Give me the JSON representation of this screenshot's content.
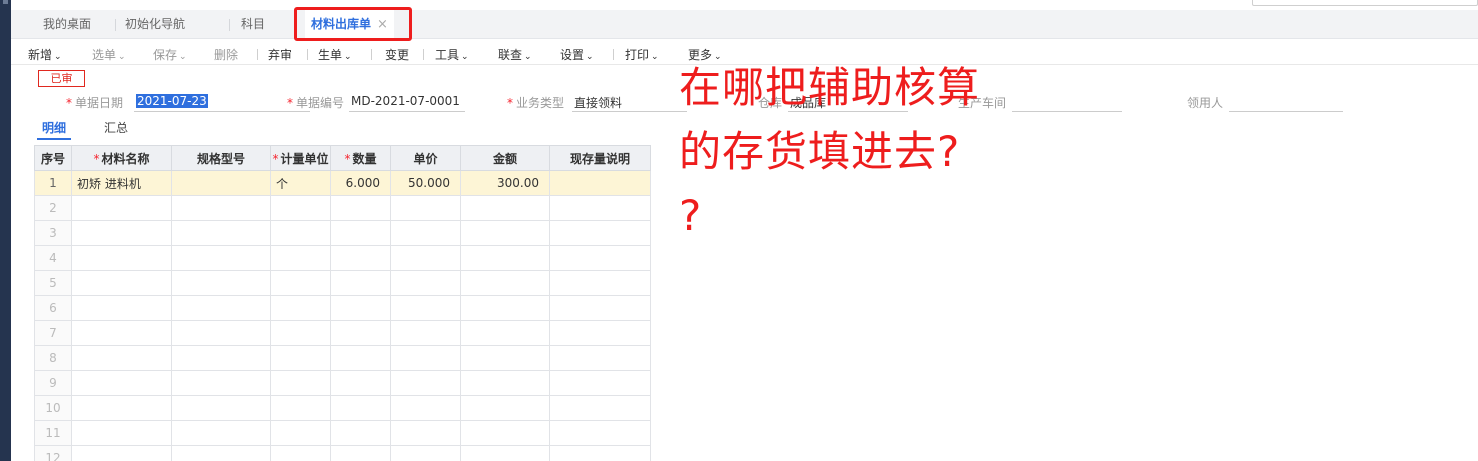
{
  "tabs": [
    {
      "label": "我的桌面",
      "active": false
    },
    {
      "label": "初始化导航",
      "active": false
    },
    {
      "label": "科目",
      "active": false
    },
    {
      "label": "材料出库单",
      "active": true
    }
  ],
  "tab_close_glyph": "×",
  "toolbar": [
    {
      "label": "新增",
      "dropdown": true,
      "disabled": false
    },
    {
      "label": "选单",
      "dropdown": true,
      "disabled": true
    },
    {
      "label": "保存",
      "dropdown": true,
      "disabled": true
    },
    {
      "label": "删除",
      "dropdown": false,
      "disabled": true
    },
    {
      "label": "弃审",
      "dropdown": false,
      "disabled": false
    },
    {
      "label": "生单",
      "dropdown": true,
      "disabled": false
    },
    {
      "label": "变更",
      "dropdown": false,
      "disabled": false
    },
    {
      "label": "工具",
      "dropdown": true,
      "disabled": false
    },
    {
      "label": "联查",
      "dropdown": true,
      "disabled": false
    },
    {
      "label": "设置",
      "dropdown": true,
      "disabled": false
    },
    {
      "label": "打印",
      "dropdown": true,
      "disabled": false
    },
    {
      "label": "更多",
      "dropdown": true,
      "disabled": false
    }
  ],
  "status_badge": "已审",
  "form": {
    "date_label": "单据日期",
    "date_value": "2021-07-23",
    "number_label": "单据编号",
    "number_value": "MD-2021-07-0001",
    "biz_type_label": "业务类型",
    "biz_type_value": "直接领料",
    "warehouse_label": "仓库",
    "warehouse_value": "成品库",
    "workshop_label": "生产车间",
    "receiver_label": "领用人",
    "receiver_value": ""
  },
  "subtabs": [
    "明细",
    "汇总"
  ],
  "grid": {
    "headers": [
      "序号",
      "材料名称",
      "规格型号",
      "计量单位",
      "数量",
      "单价",
      "金额",
      "现存量说明"
    ],
    "required_columns": [
      1,
      3,
      4
    ],
    "rows": [
      {
        "no": "1",
        "name": "初矫 进料机",
        "spec": "",
        "unit": "个",
        "qty": "6.000",
        "price": "50.000",
        "amount": "300.00",
        "note": ""
      },
      {
        "no": "2"
      },
      {
        "no": "3"
      },
      {
        "no": "4"
      },
      {
        "no": "5"
      },
      {
        "no": "6"
      },
      {
        "no": "7"
      },
      {
        "no": "8"
      },
      {
        "no": "9"
      },
      {
        "no": "10"
      },
      {
        "no": "11"
      },
      {
        "no": "12"
      }
    ]
  },
  "annotation_lines": [
    "在哪把辅助核算",
    "的存货填进去?",
    "?"
  ],
  "colors": {
    "accent": "#2f6fde",
    "annotation": "#ee1d1d",
    "required": "#f5222d",
    "row_highlight": "#fdf5d6",
    "side_nav": "#25344f"
  }
}
